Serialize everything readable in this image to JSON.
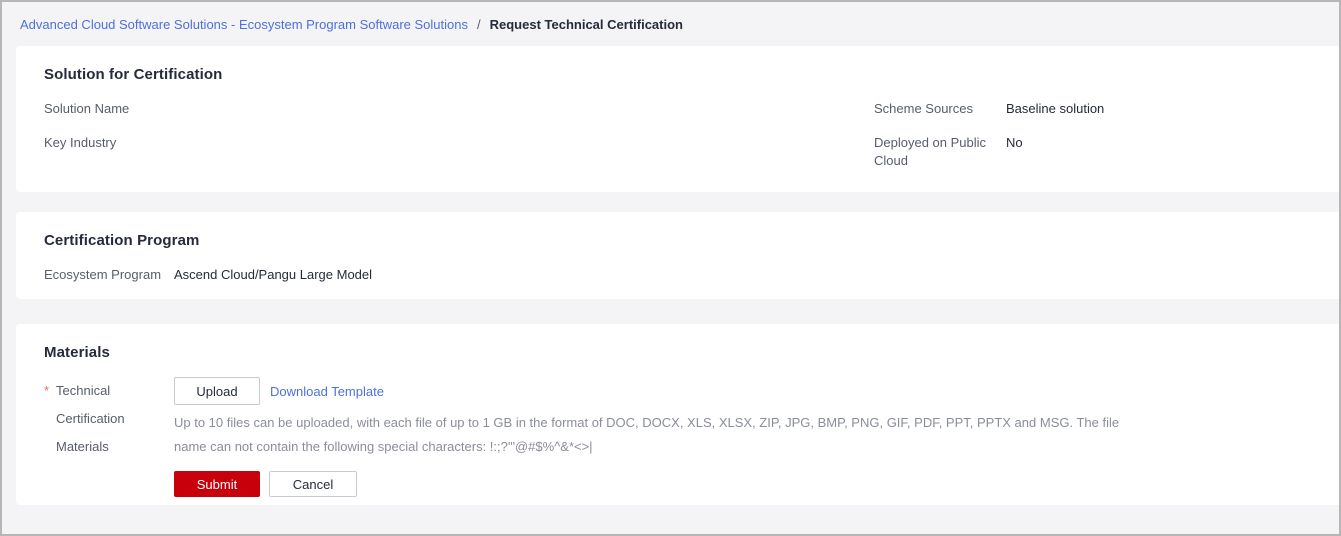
{
  "breadcrumb": {
    "link": "Advanced Cloud Software Solutions - Ecosystem Program Software Solutions",
    "separator": "/",
    "current": "Request Technical Certification"
  },
  "colors": {
    "link_blue": "#4d70dc",
    "submit_red": "#c7000b",
    "required_red": "#f0675f",
    "page_background": "#f4f4f6"
  },
  "solution_section": {
    "title": "Solution for Certification",
    "fields": {
      "solution_name": {
        "label": "Solution Name",
        "value": "",
        "redacted": true
      },
      "key_industry": {
        "label": "Key Industry",
        "value": ""
      },
      "scheme_sources": {
        "label": "Scheme Sources",
        "value": "Baseline solution"
      },
      "deployed_public_cloud": {
        "label": "Deployed on Public Cloud",
        "value": "No"
      }
    }
  },
  "program_section": {
    "title": "Certification Program",
    "fields": {
      "ecosystem_program": {
        "label": "Ecosystem Program",
        "value": "Ascend Cloud/Pangu Large Model"
      }
    }
  },
  "materials_section": {
    "title": "Materials",
    "required_marker": "*",
    "field_label": "Technical Certification Materials",
    "upload_button": "Upload",
    "download_link": "Download Template",
    "hint": "Up to 10 files can be uploaded, with each file of up to 1 GB in the format of DOC, DOCX, XLS, XLSX, ZIP, JPG, BMP, PNG, GIF, PDF, PPT, PPTX and MSG. The file name can not contain the following special characters: !:;?'\"@#$%^&*<>|",
    "submit_button": "Submit",
    "cancel_button": "Cancel"
  }
}
